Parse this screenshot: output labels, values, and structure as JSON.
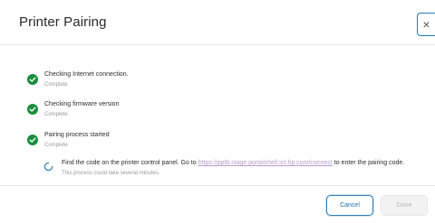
{
  "dialog": {
    "title": "Printer Pairing",
    "close_label": "×"
  },
  "steps": [
    {
      "title": "Checking Internet connection.",
      "status": "Complete",
      "icon": "check-circle-icon"
    },
    {
      "title": "Checking firmware version",
      "status": "Complete",
      "icon": "check-circle-icon"
    },
    {
      "title": "Pairing process started",
      "status": "Complete",
      "icon": "check-circle-icon"
    }
  ],
  "pairing": {
    "text_before": "Find the code on the printer control panel. Go to ",
    "link": "https://pptb.stage.portalshell.int.hp.com/connect",
    "text_after": " to enter the pairing code.",
    "subtext": "This process could take several minutes.",
    "icon": "spinner-icon"
  },
  "footer": {
    "cancel_label": "Cancel",
    "done_label": "Done"
  },
  "colors": {
    "success": "#1a8e3e",
    "accent": "#1f7fb5",
    "link": "#b59ac8"
  }
}
